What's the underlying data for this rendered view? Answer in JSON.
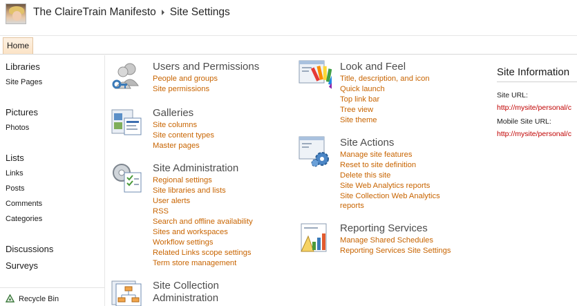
{
  "header": {
    "site_title": "The ClaireTrain Manifesto",
    "page_title": "Site Settings"
  },
  "topnav": {
    "home": "Home"
  },
  "quicklaunch": {
    "libraries": "Libraries",
    "site_pages": "Site Pages",
    "pictures": "Pictures",
    "photos": "Photos",
    "lists": "Lists",
    "links": "Links",
    "posts": "Posts",
    "comments": "Comments",
    "categories": "Categories",
    "discussions": "Discussions",
    "surveys": "Surveys",
    "recycle_bin": "Recycle Bin"
  },
  "sections": {
    "users": {
      "title": "Users and Permissions",
      "links": [
        "People and groups",
        "Site permissions"
      ]
    },
    "galleries": {
      "title": "Galleries",
      "links": [
        "Site columns",
        "Site content types",
        "Master pages"
      ]
    },
    "site_admin": {
      "title": "Site Administration",
      "links": [
        "Regional settings",
        "Site libraries and lists",
        "User alerts",
        "RSS",
        "Search and offline availability",
        "Sites and workspaces",
        "Workflow settings",
        "Related Links scope settings",
        "Term store management"
      ]
    },
    "collection_admin": {
      "title_line1": "Site Collection",
      "title_line2": "Administration"
    },
    "look_feel": {
      "title": "Look and Feel",
      "links": [
        "Title, description, and icon",
        "Quick launch",
        "Top link bar",
        "Tree view",
        "Site theme"
      ]
    },
    "site_actions": {
      "title": "Site Actions",
      "links": [
        "Manage site features",
        "Reset to site definition",
        "Delete this site",
        "Site Web Analytics reports",
        "Site Collection Web Analytics",
        "reports"
      ]
    },
    "reporting": {
      "title": "Reporting Services",
      "links": [
        "Manage Shared Schedules",
        "Reporting Services Site Settings"
      ]
    }
  },
  "site_info": {
    "title": "Site Information",
    "site_url_label": "Site URL:",
    "site_url": "http://mysite/personal/c",
    "mobile_url_label": "Mobile Site URL:",
    "mobile_url": "http://mysite/personal/c"
  }
}
